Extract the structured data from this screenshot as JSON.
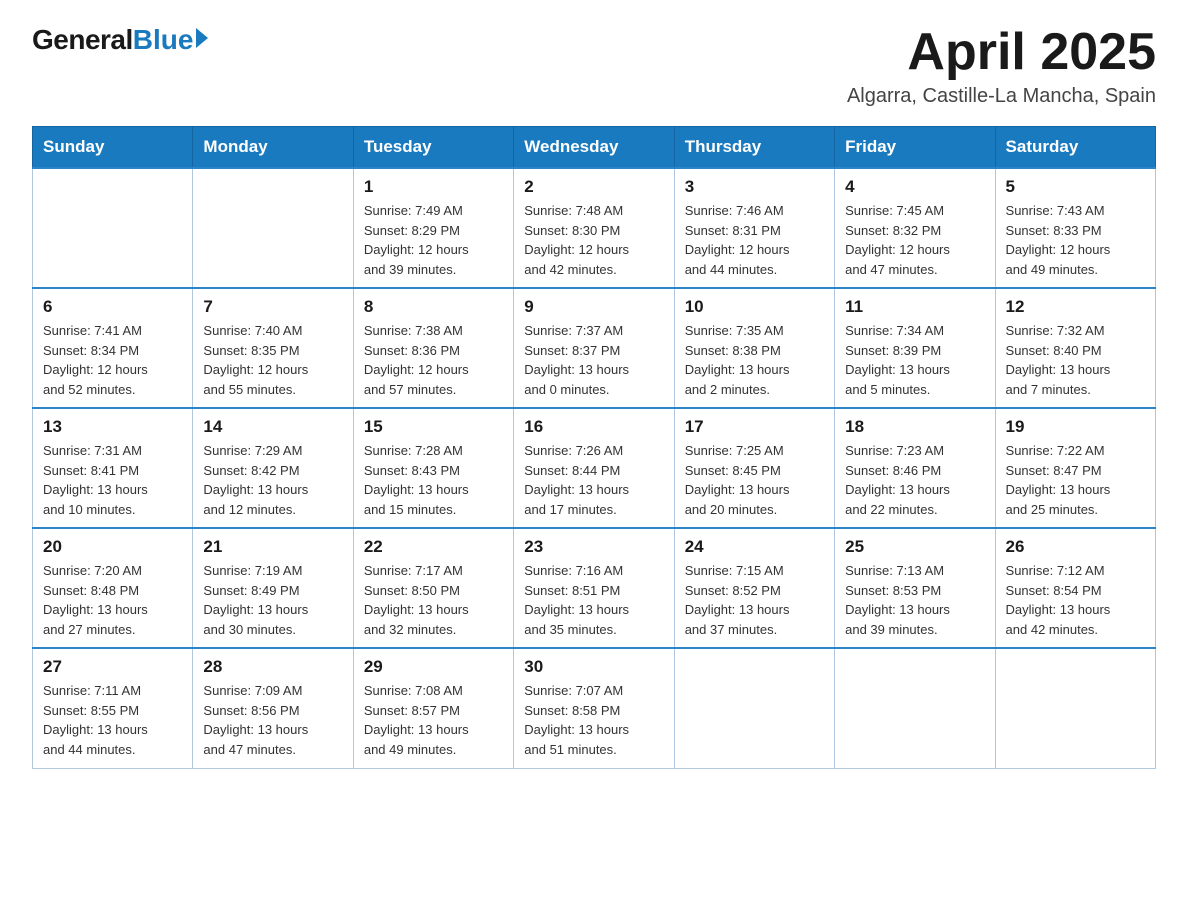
{
  "header": {
    "logo": {
      "general": "General",
      "blue": "Blue",
      "alt": "GeneralBlue logo"
    },
    "title": "April 2025",
    "subtitle": "Algarra, Castille-La Mancha, Spain"
  },
  "weekdays": [
    "Sunday",
    "Monday",
    "Tuesday",
    "Wednesday",
    "Thursday",
    "Friday",
    "Saturday"
  ],
  "weeks": [
    [
      {
        "day": "",
        "info": ""
      },
      {
        "day": "",
        "info": ""
      },
      {
        "day": "1",
        "info": "Sunrise: 7:49 AM\nSunset: 8:29 PM\nDaylight: 12 hours\nand 39 minutes."
      },
      {
        "day": "2",
        "info": "Sunrise: 7:48 AM\nSunset: 8:30 PM\nDaylight: 12 hours\nand 42 minutes."
      },
      {
        "day": "3",
        "info": "Sunrise: 7:46 AM\nSunset: 8:31 PM\nDaylight: 12 hours\nand 44 minutes."
      },
      {
        "day": "4",
        "info": "Sunrise: 7:45 AM\nSunset: 8:32 PM\nDaylight: 12 hours\nand 47 minutes."
      },
      {
        "day": "5",
        "info": "Sunrise: 7:43 AM\nSunset: 8:33 PM\nDaylight: 12 hours\nand 49 minutes."
      }
    ],
    [
      {
        "day": "6",
        "info": "Sunrise: 7:41 AM\nSunset: 8:34 PM\nDaylight: 12 hours\nand 52 minutes."
      },
      {
        "day": "7",
        "info": "Sunrise: 7:40 AM\nSunset: 8:35 PM\nDaylight: 12 hours\nand 55 minutes."
      },
      {
        "day": "8",
        "info": "Sunrise: 7:38 AM\nSunset: 8:36 PM\nDaylight: 12 hours\nand 57 minutes."
      },
      {
        "day": "9",
        "info": "Sunrise: 7:37 AM\nSunset: 8:37 PM\nDaylight: 13 hours\nand 0 minutes."
      },
      {
        "day": "10",
        "info": "Sunrise: 7:35 AM\nSunset: 8:38 PM\nDaylight: 13 hours\nand 2 minutes."
      },
      {
        "day": "11",
        "info": "Sunrise: 7:34 AM\nSunset: 8:39 PM\nDaylight: 13 hours\nand 5 minutes."
      },
      {
        "day": "12",
        "info": "Sunrise: 7:32 AM\nSunset: 8:40 PM\nDaylight: 13 hours\nand 7 minutes."
      }
    ],
    [
      {
        "day": "13",
        "info": "Sunrise: 7:31 AM\nSunset: 8:41 PM\nDaylight: 13 hours\nand 10 minutes."
      },
      {
        "day": "14",
        "info": "Sunrise: 7:29 AM\nSunset: 8:42 PM\nDaylight: 13 hours\nand 12 minutes."
      },
      {
        "day": "15",
        "info": "Sunrise: 7:28 AM\nSunset: 8:43 PM\nDaylight: 13 hours\nand 15 minutes."
      },
      {
        "day": "16",
        "info": "Sunrise: 7:26 AM\nSunset: 8:44 PM\nDaylight: 13 hours\nand 17 minutes."
      },
      {
        "day": "17",
        "info": "Sunrise: 7:25 AM\nSunset: 8:45 PM\nDaylight: 13 hours\nand 20 minutes."
      },
      {
        "day": "18",
        "info": "Sunrise: 7:23 AM\nSunset: 8:46 PM\nDaylight: 13 hours\nand 22 minutes."
      },
      {
        "day": "19",
        "info": "Sunrise: 7:22 AM\nSunset: 8:47 PM\nDaylight: 13 hours\nand 25 minutes."
      }
    ],
    [
      {
        "day": "20",
        "info": "Sunrise: 7:20 AM\nSunset: 8:48 PM\nDaylight: 13 hours\nand 27 minutes."
      },
      {
        "day": "21",
        "info": "Sunrise: 7:19 AM\nSunset: 8:49 PM\nDaylight: 13 hours\nand 30 minutes."
      },
      {
        "day": "22",
        "info": "Sunrise: 7:17 AM\nSunset: 8:50 PM\nDaylight: 13 hours\nand 32 minutes."
      },
      {
        "day": "23",
        "info": "Sunrise: 7:16 AM\nSunset: 8:51 PM\nDaylight: 13 hours\nand 35 minutes."
      },
      {
        "day": "24",
        "info": "Sunrise: 7:15 AM\nSunset: 8:52 PM\nDaylight: 13 hours\nand 37 minutes."
      },
      {
        "day": "25",
        "info": "Sunrise: 7:13 AM\nSunset: 8:53 PM\nDaylight: 13 hours\nand 39 minutes."
      },
      {
        "day": "26",
        "info": "Sunrise: 7:12 AM\nSunset: 8:54 PM\nDaylight: 13 hours\nand 42 minutes."
      }
    ],
    [
      {
        "day": "27",
        "info": "Sunrise: 7:11 AM\nSunset: 8:55 PM\nDaylight: 13 hours\nand 44 minutes."
      },
      {
        "day": "28",
        "info": "Sunrise: 7:09 AM\nSunset: 8:56 PM\nDaylight: 13 hours\nand 47 minutes."
      },
      {
        "day": "29",
        "info": "Sunrise: 7:08 AM\nSunset: 8:57 PM\nDaylight: 13 hours\nand 49 minutes."
      },
      {
        "day": "30",
        "info": "Sunrise: 7:07 AM\nSunset: 8:58 PM\nDaylight: 13 hours\nand 51 minutes."
      },
      {
        "day": "",
        "info": ""
      },
      {
        "day": "",
        "info": ""
      },
      {
        "day": "",
        "info": ""
      }
    ]
  ]
}
